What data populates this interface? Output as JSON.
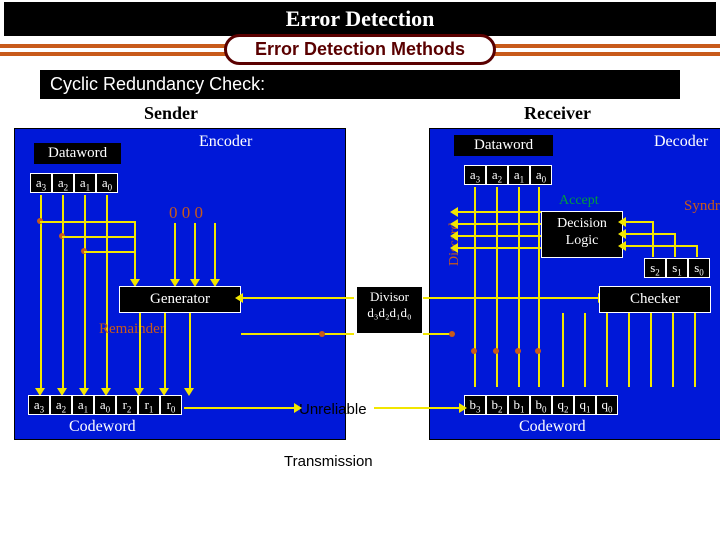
{
  "title": "Error Detection",
  "subtitle": "Error Detection Methods",
  "section": "Cyclic Redundancy Check:",
  "roles": {
    "sender": "Sender",
    "receiver": "Receiver"
  },
  "boxes": {
    "encoder": "Encoder",
    "decoder": "Decoder",
    "dataword_l": "Dataword",
    "dataword_r": "Dataword",
    "generator": "Generator",
    "checker": "Checker",
    "remainder": "Remainder",
    "codeword_l": "Codeword",
    "codeword_r": "Codeword",
    "decision": "Decision\nLogic",
    "divisor_title": "Divisor",
    "divisor_bits": "d₃d₂d₁d₀"
  },
  "labels": {
    "zeros": "0  0  0",
    "accept": "Accept",
    "syndrome": "Syndrome",
    "discard": "Discard",
    "unreliable": "Unreliable",
    "transmission": "Transmission"
  },
  "sender_data_bits": [
    "a<sub>3</sub>",
    "a<sub>2</sub>",
    "a<sub>1</sub>",
    "a<sub>0</sub>"
  ],
  "sender_code_bits": [
    "a<sub>3</sub>",
    "a<sub>2</sub>",
    "a<sub>1</sub>",
    "a<sub>0</sub>",
    "r<sub>2</sub>",
    "r<sub>1</sub>",
    "r<sub>0</sub>"
  ],
  "receiver_data_bits": [
    "a<sub>3</sub>",
    "a<sub>2</sub>",
    "a<sub>1</sub>",
    "a<sub>0</sub>"
  ],
  "receiver_code_bits": [
    "b<sub>3</sub>",
    "b<sub>2</sub>",
    "b<sub>1</sub>",
    "b<sub>0</sub>",
    "q<sub>2</sub>",
    "q<sub>1</sub>",
    "q<sub>0</sub>"
  ],
  "syndrome_bits": [
    "s<sub>2</sub>",
    "s<sub>1</sub>",
    "s<sub>0</sub>"
  ]
}
